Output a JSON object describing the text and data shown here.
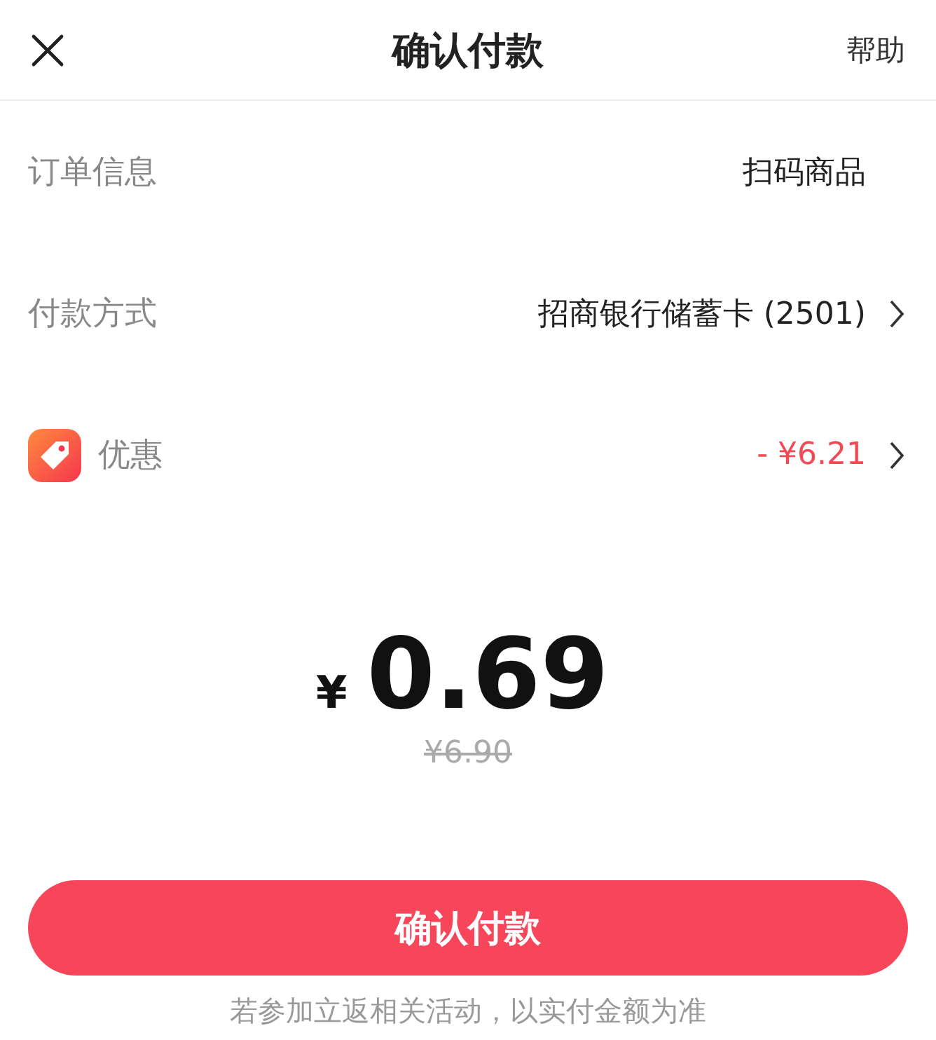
{
  "header": {
    "title": "确认付款",
    "help": "帮助"
  },
  "rows": [
    {
      "kind": "info",
      "label": "订单信息",
      "value": "扫码商品",
      "chevron": false
    },
    {
      "kind": "info",
      "label": "付款方式",
      "value": "招商银行储蓄卡 (2501)",
      "chevron": true
    },
    {
      "kind": "discount",
      "label": "优惠",
      "value": "- ¥6.21",
      "chevron": true
    }
  ],
  "amount": {
    "currency": "¥",
    "value": "0.69",
    "original": "¥6.90"
  },
  "confirm_button": "确认付款",
  "footnote": "若参加立返相关活动，以实付金额为准"
}
